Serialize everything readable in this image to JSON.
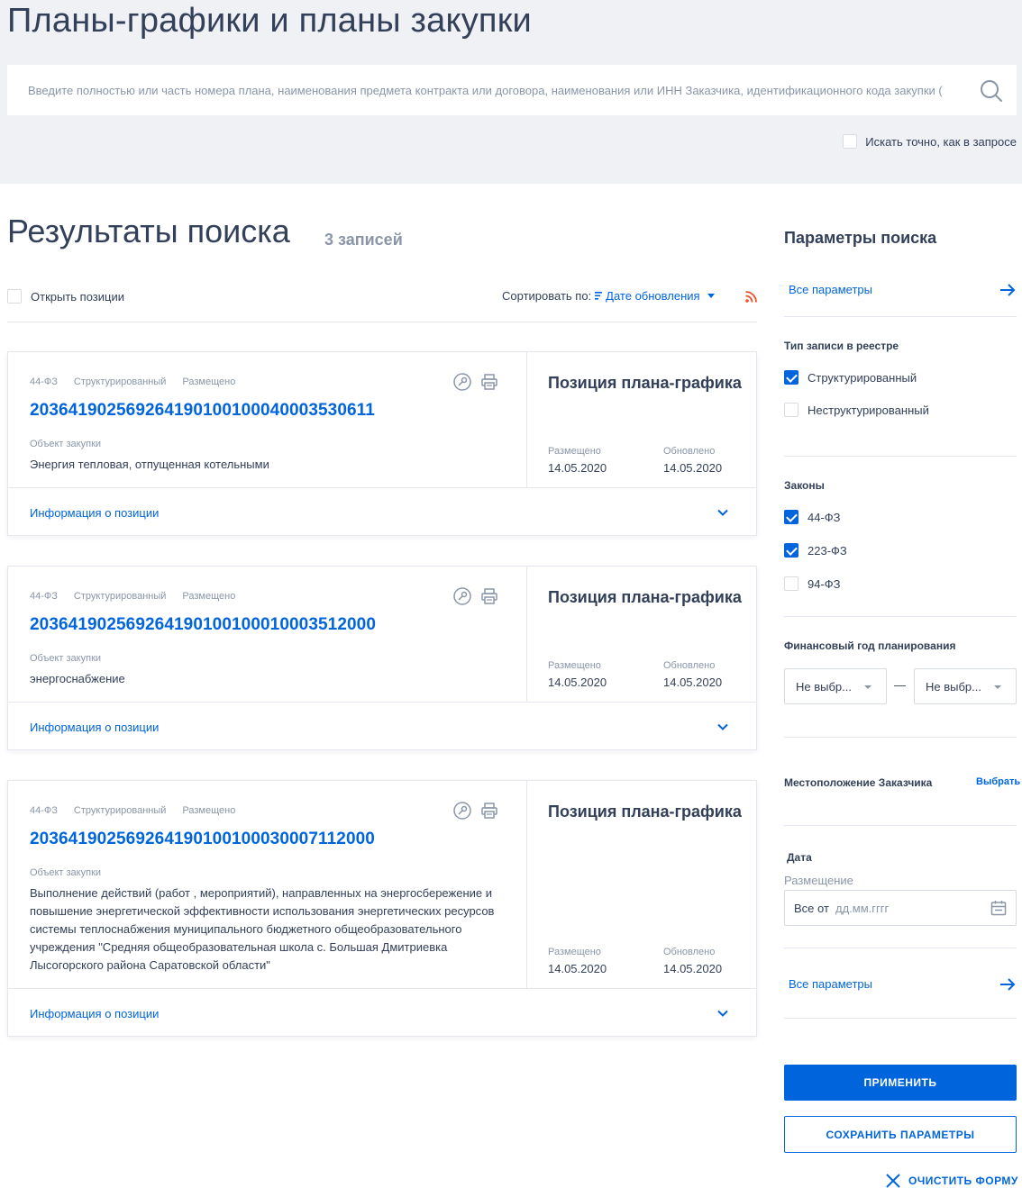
{
  "page": {
    "title": "Планы-графики и планы закупки"
  },
  "search": {
    "placeholder": "Введите полностью или часть номера плана, наименования предмета контракта или договора, наименования или ИНН Заказчика, идентификационного кода закупки (",
    "value": "",
    "exact_label": "Искать точно, как в запросе",
    "exact_checked": false
  },
  "results": {
    "title": "Результаты поиска",
    "count": "3 записей",
    "open_positions_label": "Открыть позиции",
    "sort_label": "Сортировать по:",
    "sort_value": "Дате обновления"
  },
  "cards": [
    {
      "law": "44-ФЗ",
      "type": "Структурированный",
      "status": "Размещено",
      "number": "203641902569264190100100040003530611",
      "object_label": "Объект закупки",
      "object": "Энергия тепловая, отпущенная котельными",
      "position_title": "Позиция плана-графика",
      "placed_label": "Размещено",
      "placed_date": "14.05.2020",
      "updated_label": "Обновлено",
      "updated_date": "14.05.2020",
      "info_label": "Информация о позиции"
    },
    {
      "law": "44-ФЗ",
      "type": "Структурированный",
      "status": "Размещено",
      "number": "203641902569264190100100010003512000",
      "object_label": "Объект закупки",
      "object": "энергоснабжение",
      "position_title": "Позиция плана-графика",
      "placed_label": "Размещено",
      "placed_date": "14.05.2020",
      "updated_label": "Обновлено",
      "updated_date": "14.05.2020",
      "info_label": "Информация о позиции"
    },
    {
      "law": "44-ФЗ",
      "type": "Структурированный",
      "status": "Размещено",
      "number": "203641902569264190100100030007112000",
      "object_label": "Объект закупки",
      "object": "Выполнение действий (работ , мероприятий), направленных на энергосбережение и повышение энергетической эффективности использования энергетических ресурсов системы теплоснабжения муниципального бюджетного общеобразовательного учреждения \"Средняя общеобразовательная школа с. Большая Дмитриевка Лысогорского района Саратовской области\"",
      "position_title": "Позиция плана-графика",
      "placed_label": "Размещено",
      "placed_date": "14.05.2020",
      "updated_label": "Обновлено",
      "updated_date": "14.05.2020",
      "info_label": "Информация о позиции"
    }
  ],
  "sidebar": {
    "title": "Параметры поиска",
    "all_params": "Все параметры",
    "record_type": {
      "title": "Тип записи в реестре",
      "options": [
        {
          "label": "Структурированный",
          "checked": true
        },
        {
          "label": "Неструктурированный",
          "checked": false
        }
      ]
    },
    "laws": {
      "title": "Законы",
      "options": [
        {
          "label": "44-ФЗ",
          "checked": true
        },
        {
          "label": "223-ФЗ",
          "checked": true
        },
        {
          "label": "94-ФЗ",
          "checked": false
        }
      ]
    },
    "fin_year": {
      "title": "Финансовый год планирования",
      "from": "Не выбр...",
      "to": "Не выбр...",
      "separator": "—"
    },
    "location": {
      "title": "Местоположение Заказчика",
      "choose": "Выбрать"
    },
    "date": {
      "title": "Дата",
      "sub_label": "Размещение",
      "prefix": "Все от",
      "placeholder": "дд.мм.гггг"
    },
    "apply": "ПРИМЕНИТЬ",
    "save": "СОХРАНИТЬ ПАРАМЕТРЫ",
    "clear": "ОЧИСТИТЬ ФОРМУ"
  },
  "colors": {
    "accent": "#0065dd",
    "text": "#334059",
    "muted": "#8a96a8",
    "hero_bg": "#eff1f5",
    "rss": "#f04e23"
  }
}
